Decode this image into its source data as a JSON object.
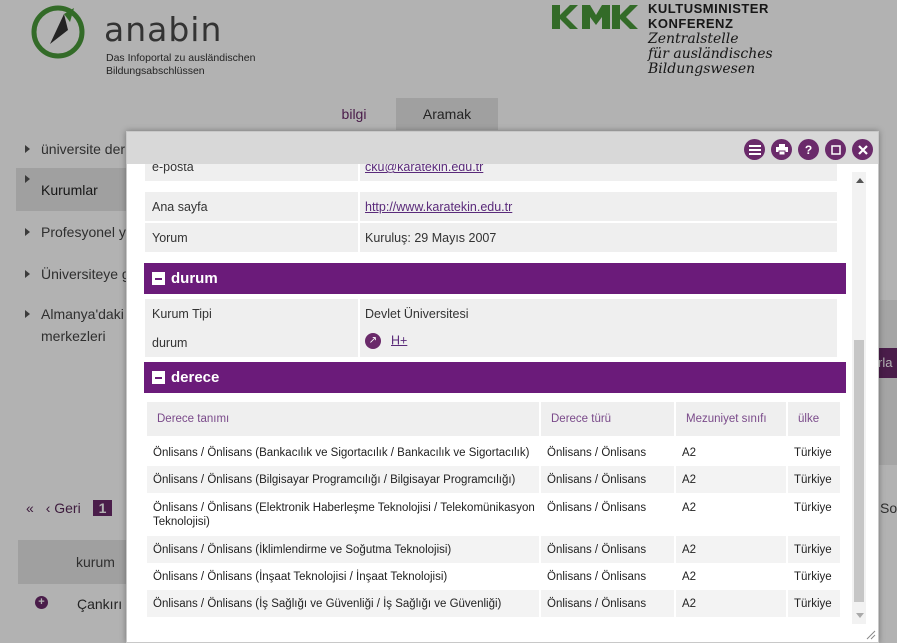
{
  "header": {
    "logo_word": "anabin",
    "logo_tagline": "Das Infoportal zu ausländischen Bildungsabschlüssen",
    "kmk_title_1": "KULTUSMINISTER",
    "kmk_title_2": "KONFERENZ",
    "kmk_sub_1": "Zentralstelle",
    "kmk_sub_2": "für ausländisches",
    "kmk_sub_3": "Bildungswesen"
  },
  "tabs": {
    "bilgi": "bilgi",
    "aramak": "Aramak"
  },
  "sidebar": {
    "items": [
      {
        "label": "üniversite der"
      },
      {
        "label": "Kurumlar"
      },
      {
        "label": "Profesyonel y"
      },
      {
        "label": "Üniversiteye g"
      },
      {
        "label": "Almanya'daki merkezleri"
      }
    ]
  },
  "pager": {
    "first": "«",
    "prev": "‹ Geri",
    "current": "1"
  },
  "background_misc": {
    "so_text": "So",
    "table_col": "kurum",
    "row_text": "Çankırı I",
    "right_btn": "rla"
  },
  "dialog": {
    "contact_rows": [
      {
        "key": "e-posta",
        "value": "cku@karatekin.edu.tr"
      },
      {
        "key": "Ana sayfa",
        "value": "http://www.karatekin.edu.tr"
      },
      {
        "key": "Yorum",
        "value": "Kuruluş: 29 Mayıs 2007"
      }
    ],
    "durum_section": {
      "title": "durum",
      "rows": [
        {
          "key": "Kurum Tipi",
          "value": "Devlet Üniversitesi"
        },
        {
          "key": "durum",
          "value": "H+"
        }
      ]
    },
    "derece_section": {
      "title": "derece",
      "headers": [
        "Derece tanımı",
        "Derece türü",
        "Mezuniyet sınıfı",
        "ülke"
      ],
      "rows": [
        [
          "Önlisans / Önlisans (Bankacılık ve Sigortacılık / Bankacılık ve Sigortacılık)",
          "Önlisans / Önlisans",
          "A2",
          "Türkiye"
        ],
        [
          "Önlisans / Önlisans (Bilgisayar Programcılığı / Bilgisayar Programcılığı)",
          "Önlisans / Önlisans",
          "A2",
          "Türkiye"
        ],
        [
          "Önlisans / Önlisans (Elektronik Haberleşme Teknolojisi / Telekomünikasyon Teknolojisi)",
          "Önlisans / Önlisans",
          "A2",
          "Türkiye"
        ],
        [
          "Önlisans / Önlisans (İklimlendirme ve Soğutma Teknolojisi)",
          "Önlisans / Önlisans",
          "A2",
          "Türkiye"
        ],
        [
          "Önlisans / Önlisans (İnşaat Teknolojisi / İnşaat Teknolojisi)",
          "Önlisans / Önlisans",
          "A2",
          "Türkiye"
        ],
        [
          "Önlisans / Önlisans (İş Sağlığı ve Güvenliği / İş Sağlığı ve Güvenliği)",
          "Önlisans / Önlisans",
          "A2",
          "Türkiye"
        ]
      ]
    },
    "toolbar_icons": [
      "list-icon",
      "print-icon",
      "help-icon",
      "maximize-icon",
      "close-icon"
    ]
  },
  "colors": {
    "brand_purple": "#6b1b7a",
    "kmk_green": "#4a9a3a"
  }
}
